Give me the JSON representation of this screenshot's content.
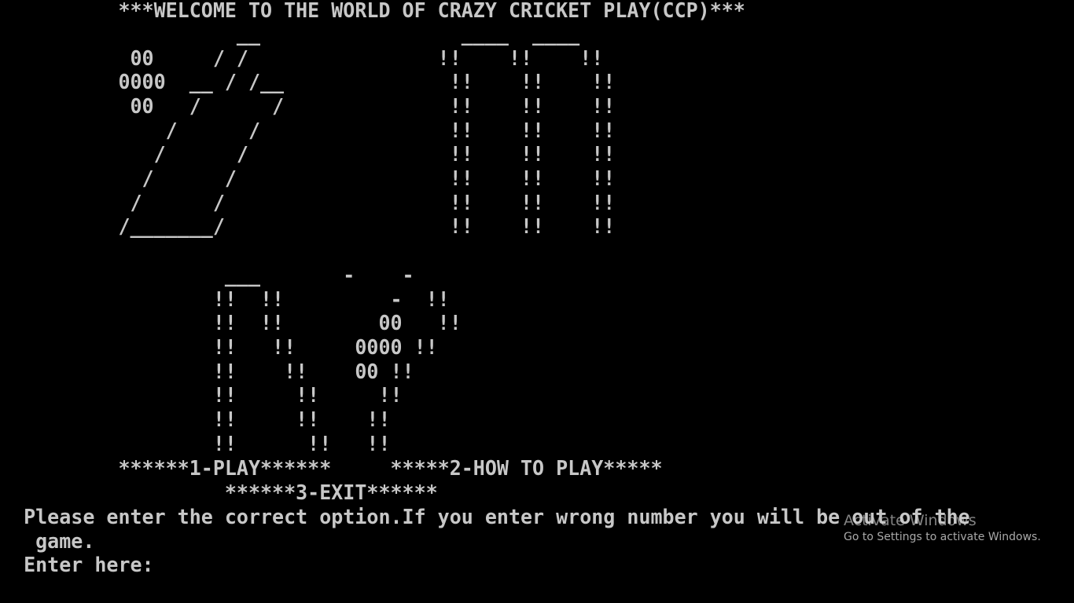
{
  "console": {
    "lines": [
      "          ***WELCOME TO THE WORLD OF CRAZY CRICKET PLAY(CCP)***",
      "                    __                 ____  ____",
      "           00     / /                !!    !!    !!",
      "          0000  __ / /__              !!    !!    !!",
      "           00   /      /              !!    !!    !!",
      "              /      /                !!    !!    !!",
      "             /      /                 !!    !!    !!",
      "            /      /                  !!    !!    !!",
      "           /      /                   !!    !!    !!",
      "          /_______/                   !!    !!    !!",
      "",
      "                   ___       -    -",
      "                  !!  !!         -  !!",
      "                  !!  !!        00   !!",
      "                  !!   !!     0000 !!",
      "                  !!    !!    00 !!",
      "                  !!     !!     !!",
      "                  !!     !!    !!",
      "                  !!      !!   !!",
      "          ******1-PLAY******     *****2-HOW TO PLAY*****",
      "                   ******3-EXIT******",
      "  Please enter the correct option.If you enter wrong number you will be out of the",
      "   game.",
      "  Enter here:"
    ]
  },
  "watermark": {
    "title": "Activate Windows",
    "subtitle": "Go to Settings to activate Windows."
  }
}
